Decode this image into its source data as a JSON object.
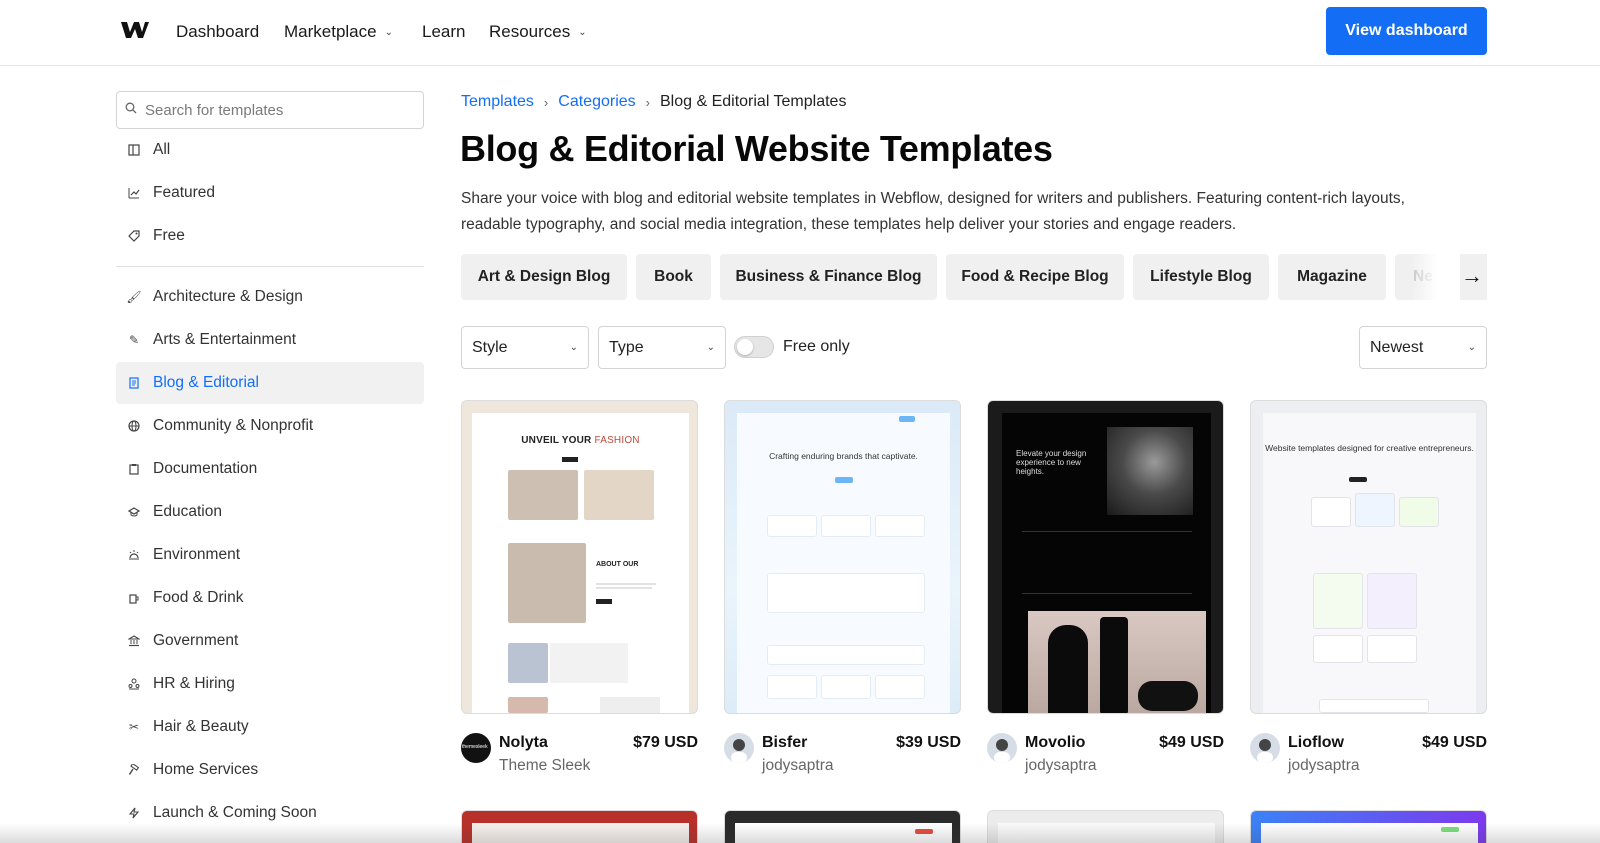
{
  "topnav": {
    "logo_icon": "webflow-logo-icon",
    "items": [
      {
        "label": "Dashboard",
        "has_dropdown": false
      },
      {
        "label": "Marketplace",
        "has_dropdown": true
      },
      {
        "label": "Learn",
        "has_dropdown": false
      },
      {
        "label": "Resources",
        "has_dropdown": true
      }
    ],
    "cta_label": "View dashboard",
    "cta_color": "#146ef5"
  },
  "sidebar": {
    "search_placeholder": "Search for templates",
    "top_items": [
      {
        "label": "All",
        "icon": "layout-icon"
      },
      {
        "label": "Featured",
        "icon": "chart-icon"
      },
      {
        "label": "Free",
        "icon": "tag-icon"
      }
    ],
    "categories": [
      {
        "label": "Architecture & Design",
        "icon": "brush-icon",
        "active": false
      },
      {
        "label": "Arts & Entertainment",
        "icon": "pen-icon",
        "active": false
      },
      {
        "label": "Blog & Editorial",
        "icon": "document-icon",
        "active": true
      },
      {
        "label": "Community & Nonprofit",
        "icon": "globe-icon",
        "active": false
      },
      {
        "label": "Documentation",
        "icon": "clipboard-icon",
        "active": false
      },
      {
        "label": "Education",
        "icon": "graduation-cap-icon",
        "active": false
      },
      {
        "label": "Environment",
        "icon": "sun-icon",
        "active": false
      },
      {
        "label": "Food & Drink",
        "icon": "cup-icon",
        "active": false
      },
      {
        "label": "Government",
        "icon": "bank-icon",
        "active": false
      },
      {
        "label": "HR & Hiring",
        "icon": "people-icon",
        "active": false
      },
      {
        "label": "Hair & Beauty",
        "icon": "scissors-icon",
        "active": false
      },
      {
        "label": "Home Services",
        "icon": "hammer-icon",
        "active": false
      },
      {
        "label": "Launch & Coming Soon",
        "icon": "lightning-icon",
        "active": false
      }
    ]
  },
  "breadcrumb": {
    "items": [
      "Templates",
      "Categories"
    ],
    "current": "Blog & Editorial Templates"
  },
  "page": {
    "title": "Blog & Editorial Website Templates",
    "description": "Share your voice with blog and editorial website templates in Webflow, designed for writers and publishers. Featuring content-rich layouts, readable typography, and social media integration, these templates help deliver your stories and engage readers."
  },
  "subcategories": [
    "Art & Design Blog",
    "Book",
    "Business & Finance Blog",
    "Food & Recipe Blog",
    "Lifestyle Blog",
    "Magazine",
    "Ne"
  ],
  "filters": {
    "style": "Style",
    "type": "Type",
    "free_only_label": "Free only",
    "free_only": false,
    "sort": "Newest"
  },
  "templates": [
    {
      "name": "Nolyta",
      "author": "Theme Sleek",
      "price": "$79 USD",
      "avatar_text": "themesleek",
      "thumb_headline_a": "UNVEIL YOUR ",
      "thumb_headline_b": "FASHION",
      "thumb_section": "ABOUT OUR"
    },
    {
      "name": "Bisfer",
      "author": "jodysaptra",
      "price": "$39 USD",
      "thumb_headline": "Crafting enduring brands that captivate."
    },
    {
      "name": "Movolio",
      "author": "jodysaptra",
      "price": "$49 USD",
      "thumb_headline": "Elevate your design experience to new heights."
    },
    {
      "name": "Lioflow",
      "author": "jodysaptra",
      "price": "$49 USD",
      "thumb_headline": "Website templates designed for creative entrepreneurs."
    }
  ]
}
